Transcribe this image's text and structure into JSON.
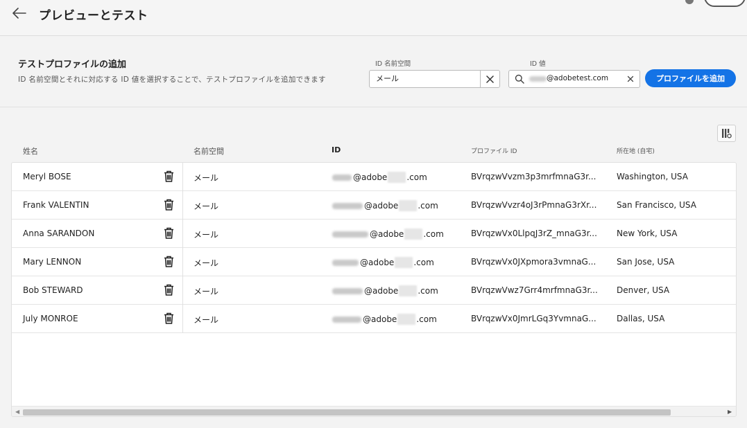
{
  "header": {
    "title": "プレビューとテスト"
  },
  "add_profile": {
    "title": "テストプロファイルの追加",
    "description": "ID 名前空間とそれに対応する ID 値を選択することで、テストプロファイルを追加できます",
    "namespace_label": "ID 名前空間",
    "namespace_value": "メール",
    "id_label": "ID 値",
    "id_value": "@adobetest.com",
    "add_button": "プロファイルを追加"
  },
  "table": {
    "columns": {
      "name": "姓名",
      "namespace": "名前空間",
      "id": "ID",
      "profile_id": "プロファイル ID",
      "location": "所在地 (自宅)"
    },
    "rows": [
      {
        "name": "Meryl BOSE",
        "namespace": "メール",
        "id_user": "bose",
        "id_domain": "@adobe",
        "id_tld": ".com",
        "profile_id": "BVrqzwVvzm3p3mrfmnaG3r...",
        "location": "Washington, USA"
      },
      {
        "name": "Frank VALENTIN",
        "namespace": "メール",
        "id_user": "valentin",
        "id_domain": "@adobe",
        "id_tld": ".com",
        "profile_id": "BVrqzwVvzr4oJ3rPmnaG3rXr...",
        "location": "San Francisco, USA"
      },
      {
        "name": "Anna SARANDON",
        "namespace": "メール",
        "id_user": "sarandon",
        "id_domain": "@adobe",
        "id_tld": ".com",
        "profile_id": "BVrqzwVx0LlpqJ3rZ_mnaG3r...",
        "location": "New York, USA"
      },
      {
        "name": "Mary LENNON",
        "namespace": "メール",
        "id_user": "lennon",
        "id_domain": "@adobe",
        "id_tld": ".com",
        "profile_id": "BVrqzwVx0JXpmora3vmnaG...",
        "location": "San Jose, USA"
      },
      {
        "name": "Bob STEWARD",
        "namespace": "メール",
        "id_user": "steward",
        "id_domain": "@adobe",
        "id_tld": ".com",
        "profile_id": "BVrqzwVwz7Grr4mrfmnaG3r...",
        "location": "Denver, USA"
      },
      {
        "name": "July MONROE",
        "namespace": "メール",
        "id_user": "monroe",
        "id_domain": "@adobe",
        "id_tld": ".com",
        "profile_id": "BVrqzwVx0JmrLGq3YvmnaG...",
        "location": "Dallas, USA"
      }
    ]
  },
  "icons": {
    "back": "arrow-left-icon",
    "clear": "close-icon",
    "search": "search-icon",
    "delete": "trash-icon",
    "settings": "column-settings-icon"
  },
  "colors": {
    "accent": "#1473e6"
  }
}
